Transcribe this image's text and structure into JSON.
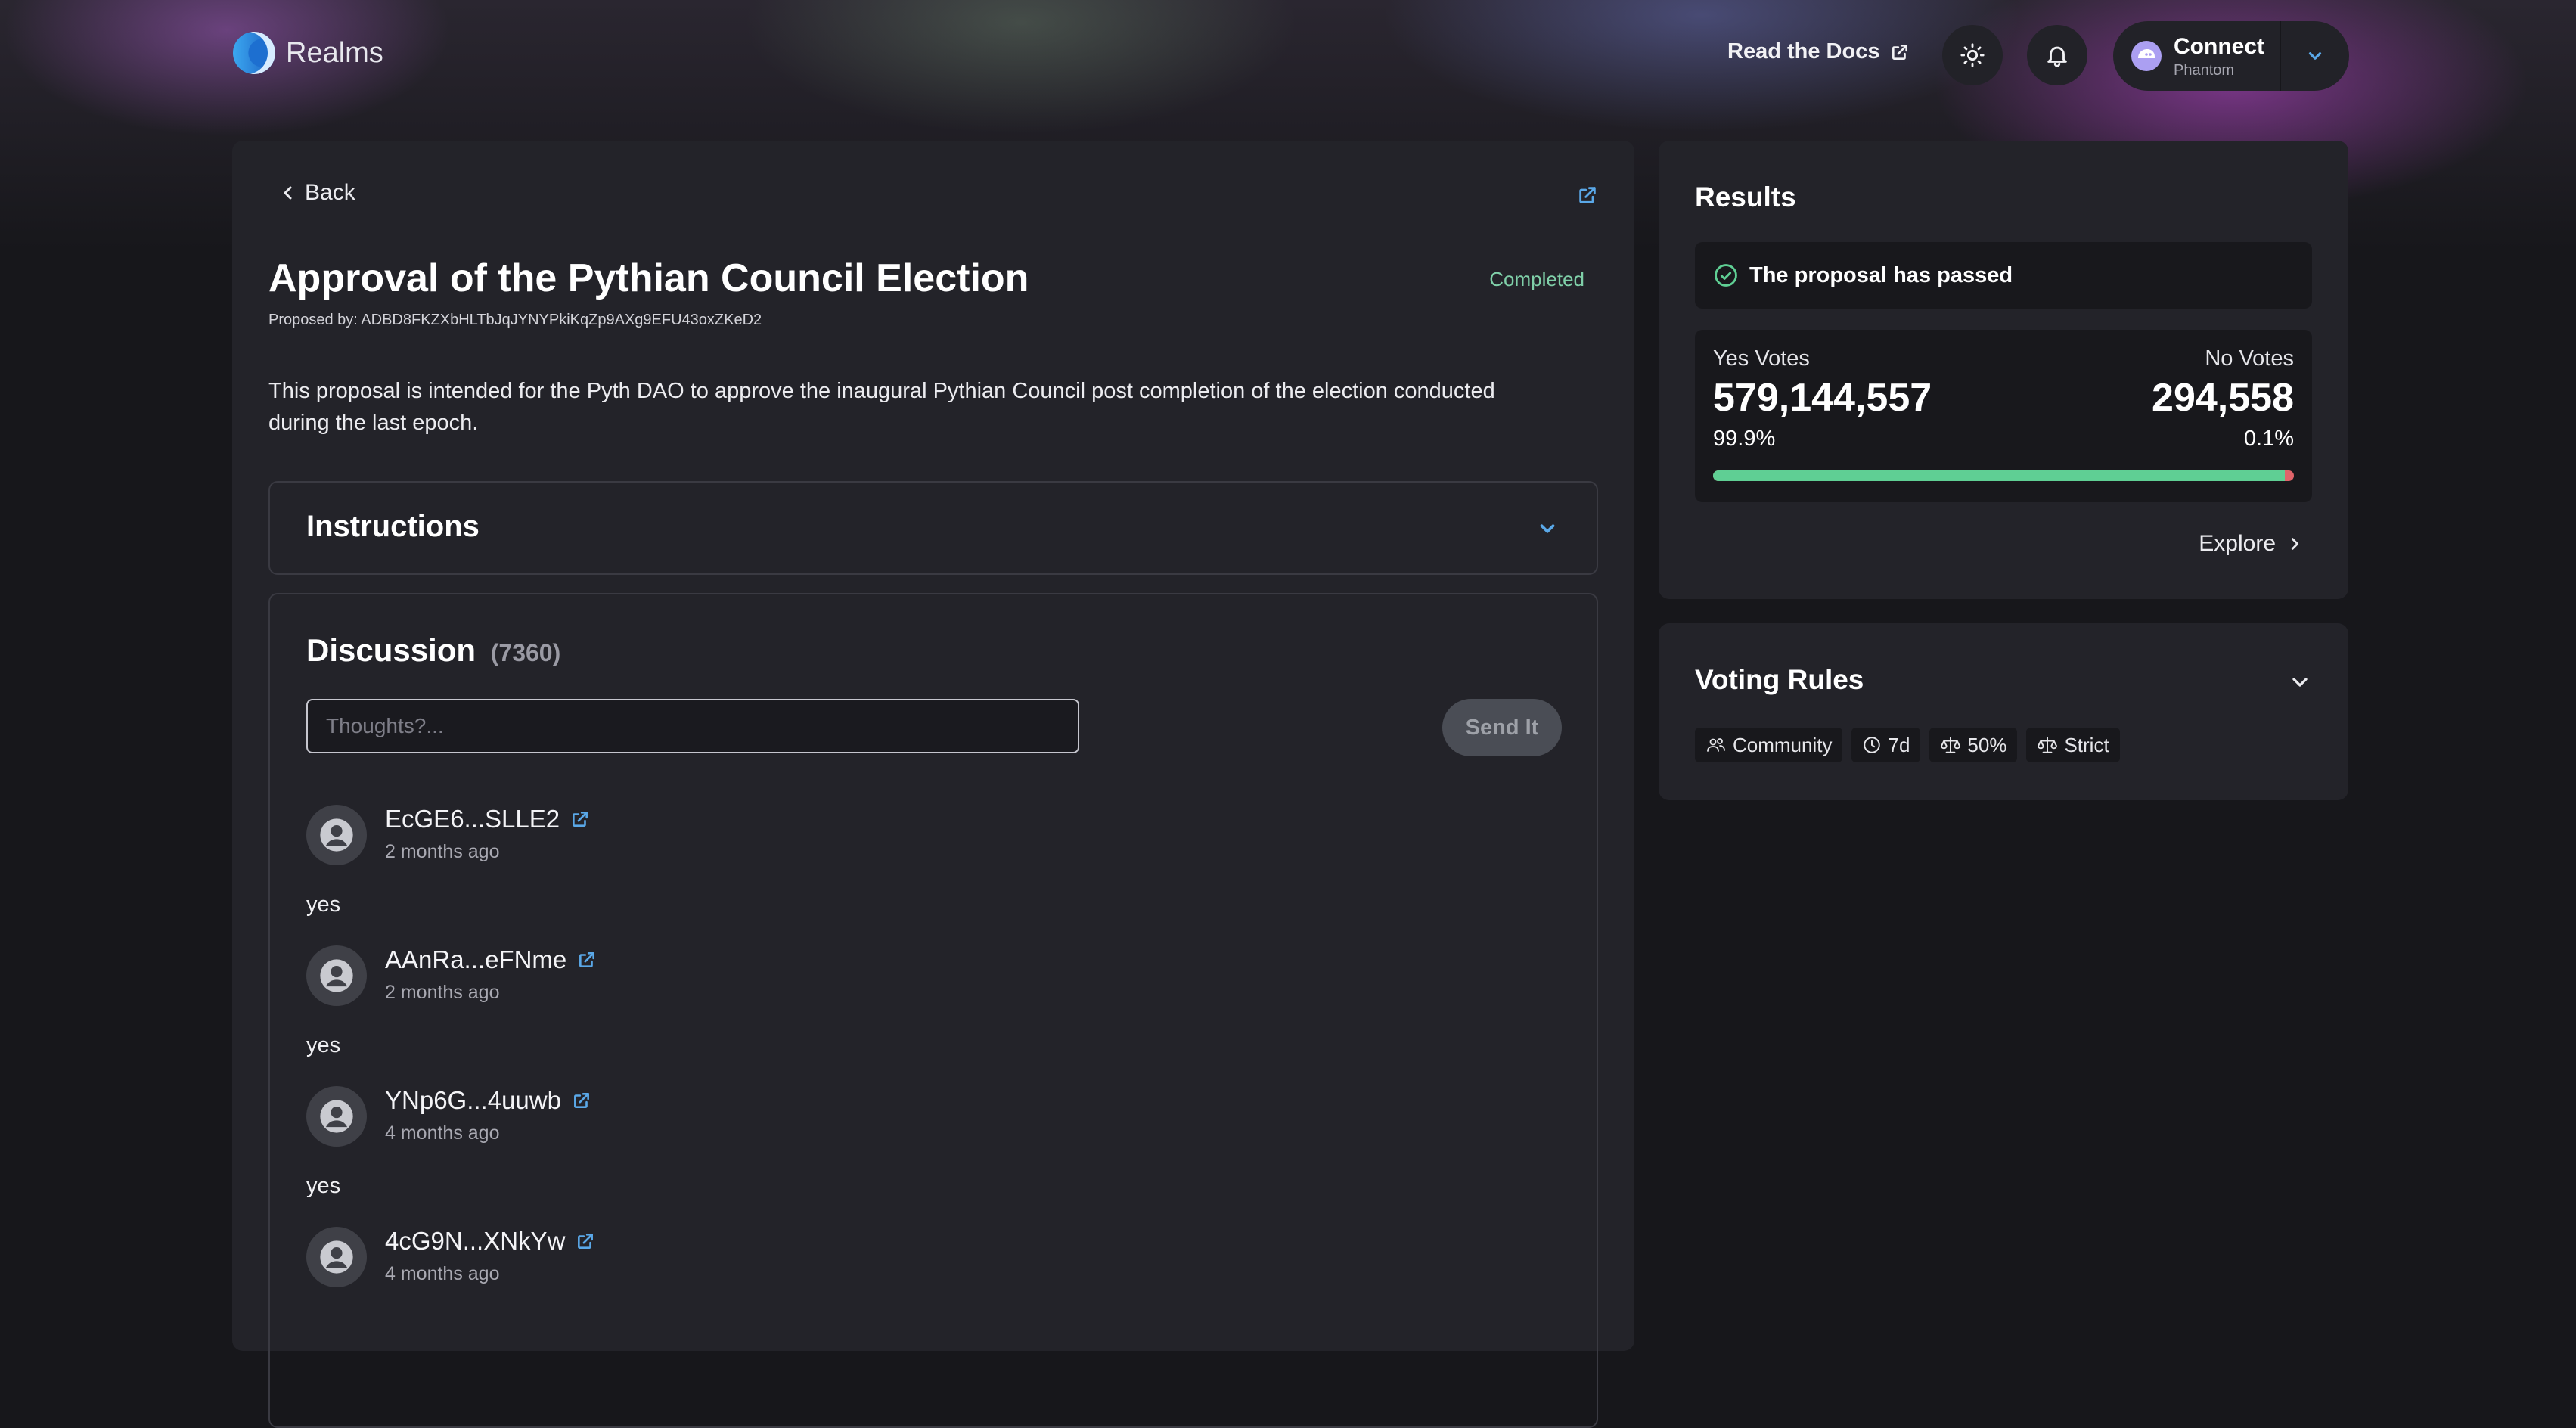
{
  "header": {
    "app_name": "Realms",
    "docs_label": "Read the Docs",
    "connect_label": "Connect",
    "wallet_name": "Phantom"
  },
  "proposal": {
    "back_label": "Back",
    "title": "Approval of the Pythian Council Election",
    "status": "Completed",
    "proposer": "Proposed by: ADBD8FKZXbHLTbJqJYNYPkiKqZp9AXg9EFU43oxZKeD2",
    "description": "This proposal is intended for the Pyth DAO to approve the inaugural Pythian Council post completion of the election conducted during the last epoch.",
    "instructions_label": "Instructions"
  },
  "discussion": {
    "title": "Discussion",
    "count": "(7360)",
    "input_placeholder": "Thoughts?...",
    "send_label": "Send It",
    "comments": [
      {
        "author": "EcGE6...SLLE2",
        "time": "2 months ago",
        "text": "yes"
      },
      {
        "author": "AAnRa...eFNme",
        "time": "2 months ago",
        "text": "yes"
      },
      {
        "author": "YNp6G...4uuwb",
        "time": "4 months ago",
        "text": "yes"
      },
      {
        "author": "4cG9N...XNkYw",
        "time": "4 months ago",
        "text": ""
      }
    ]
  },
  "results": {
    "title": "Results",
    "passed_text": "The proposal has passed",
    "yes_label": "Yes Votes",
    "no_label": "No Votes",
    "yes_votes": "579,144,557",
    "no_votes": "294,558",
    "yes_pct": "99.9%",
    "no_pct": "0.1%",
    "yes_fraction": 0.985,
    "explore_label": "Explore"
  },
  "voting_rules": {
    "title": "Voting Rules",
    "chips": [
      {
        "icon": "community-icon",
        "label": "Community"
      },
      {
        "icon": "clock-icon",
        "label": "7d"
      },
      {
        "icon": "scale-icon",
        "label": "50%"
      },
      {
        "icon": "scale-icon",
        "label": "Strict"
      }
    ]
  },
  "colors": {
    "background": "#17171b",
    "card": "#232329",
    "success": "#5fcf94",
    "danger": "#e0646a",
    "accent": "#5aa8e8"
  }
}
